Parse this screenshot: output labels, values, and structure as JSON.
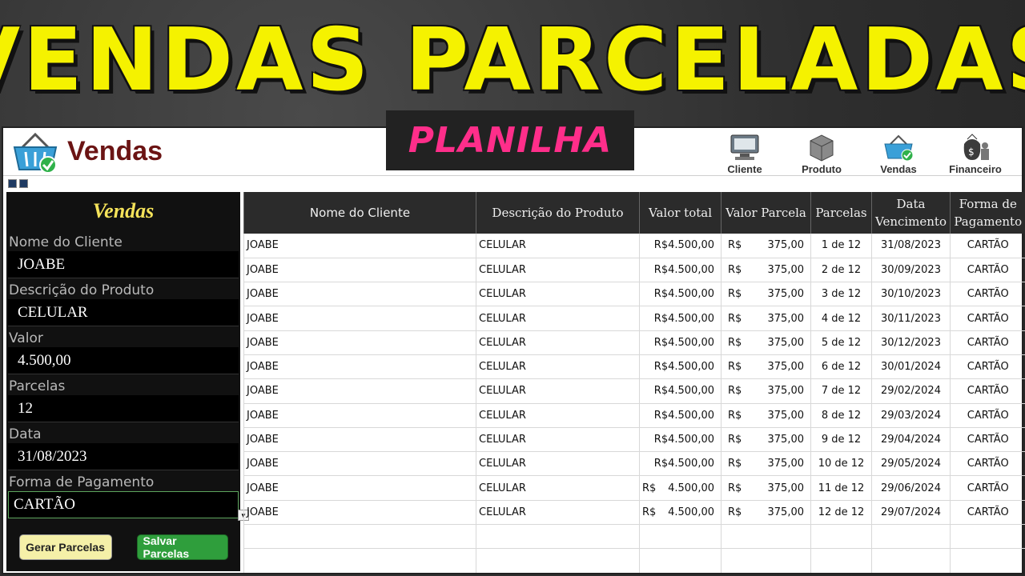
{
  "banner": {
    "title": "VENDAS PARCELADAS",
    "subtitle": "PLANILHA"
  },
  "app": {
    "title": "Vendas",
    "nav": [
      {
        "label": "Cliente",
        "icon": "computer-icon"
      },
      {
        "label": "Produto",
        "icon": "box-icon"
      },
      {
        "label": "Vendas",
        "icon": "basket-icon"
      },
      {
        "label": "Financeiro",
        "icon": "money-bag-icon"
      }
    ]
  },
  "form": {
    "title": "Vendas",
    "fields": [
      {
        "label": "Nome do Cliente",
        "value": "JOABE"
      },
      {
        "label": "Descrição do Produto",
        "value": "CELULAR"
      },
      {
        "label": "Valor",
        "value": "4.500,00"
      },
      {
        "label": "Parcelas",
        "value": "12"
      },
      {
        "label": "Data",
        "value": "31/08/2023"
      },
      {
        "label": "Forma de Pagamento",
        "value": "CARTÃO"
      }
    ],
    "buttons": {
      "gerar": "Gerar Parcelas",
      "salvar": "Salvar Parcelas"
    }
  },
  "table": {
    "headers": [
      "Nome do Cliente",
      "Descrição do Produto",
      "Valor total",
      "Valor Parcela",
      "Parcelas",
      "Data Vencimento",
      "Forma de Pagamento"
    ],
    "rows": [
      [
        "JOABE",
        "CELULAR",
        "R$4.500,00",
        "R$",
        "375,00",
        "1 de 12",
        "31/08/2023",
        "CARTÃO"
      ],
      [
        "JOABE",
        "CELULAR",
        "R$4.500,00",
        "R$",
        "375,00",
        "2 de 12",
        "30/09/2023",
        "CARTÃO"
      ],
      [
        "JOABE",
        "CELULAR",
        "R$4.500,00",
        "R$",
        "375,00",
        "3 de 12",
        "30/10/2023",
        "CARTÃO"
      ],
      [
        "JOABE",
        "CELULAR",
        "R$4.500,00",
        "R$",
        "375,00",
        "4 de 12",
        "30/11/2023",
        "CARTÃO"
      ],
      [
        "JOABE",
        "CELULAR",
        "R$4.500,00",
        "R$",
        "375,00",
        "5 de 12",
        "30/12/2023",
        "CARTÃO"
      ],
      [
        "JOABE",
        "CELULAR",
        "R$4.500,00",
        "R$",
        "375,00",
        "6 de 12",
        "30/01/2024",
        "CARTÃO"
      ],
      [
        "JOABE",
        "CELULAR",
        "R$4.500,00",
        "R$",
        "375,00",
        "7 de 12",
        "29/02/2024",
        "CARTÃO"
      ],
      [
        "JOABE",
        "CELULAR",
        "R$4.500,00",
        "R$",
        "375,00",
        "8 de 12",
        "29/03/2024",
        "CARTÃO"
      ],
      [
        "JOABE",
        "CELULAR",
        "R$4.500,00",
        "R$",
        "375,00",
        "9 de 12",
        "29/04/2024",
        "CARTÃO"
      ],
      [
        "JOABE",
        "CELULAR",
        "R$4.500,00",
        "R$",
        "375,00",
        "10 de 12",
        "29/05/2024",
        "CARTÃO"
      ],
      [
        "JOABE",
        "CELULAR",
        "R$ 4.500,00",
        "R$",
        "375,00",
        "11 de 12",
        "29/06/2024",
        "CARTÃO"
      ],
      [
        "JOABE",
        "CELULAR",
        "R$ 4.500,00",
        "R$",
        "375,00",
        "12 de 12",
        "29/07/2024",
        "CARTÃO"
      ],
      [
        "",
        "",
        "",
        "",
        "",
        "",
        "",
        ""
      ],
      [
        "",
        "",
        "",
        "",
        "",
        "",
        "",
        ""
      ]
    ]
  },
  "colors": {
    "banner_yellow": "#f5f200",
    "subtitle_pink": "#ff2e8a",
    "title_maroon": "#6b1414",
    "save_green": "#2f9e3c"
  }
}
